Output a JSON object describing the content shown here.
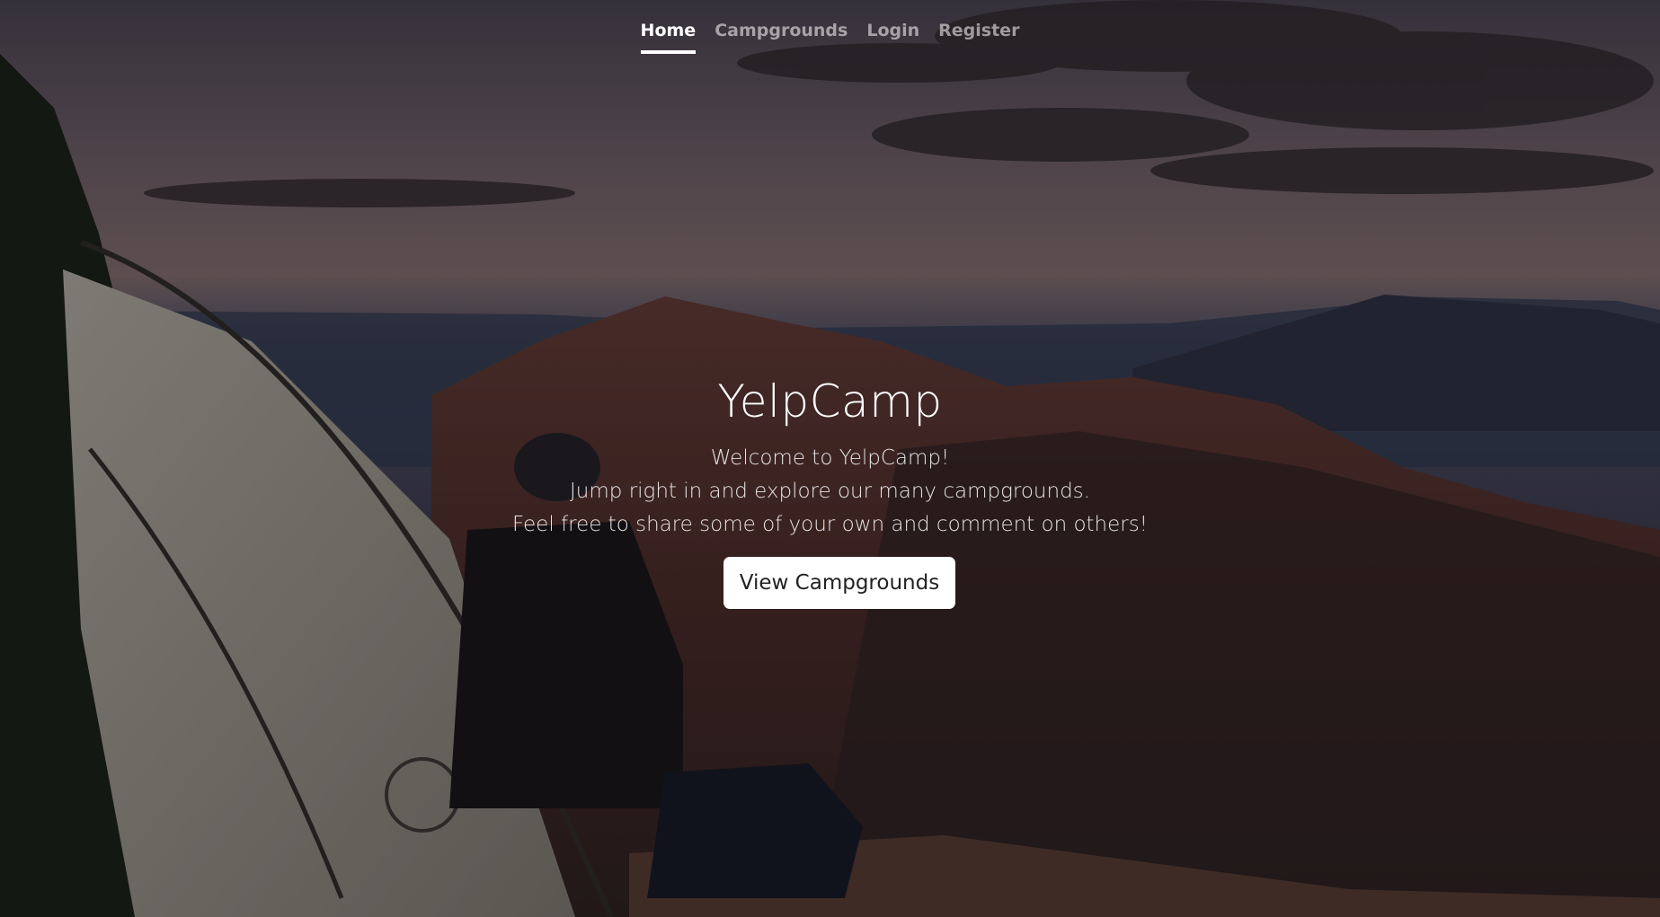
{
  "nav": {
    "items": [
      {
        "label": "Home",
        "active": true
      },
      {
        "label": "Campgrounds",
        "active": false
      },
      {
        "label": "Login",
        "active": false
      },
      {
        "label": "Register",
        "active": false
      }
    ]
  },
  "hero": {
    "title": "YelpCamp",
    "lines": [
      "Welcome to YelpCamp!",
      "Jump right in and explore our many campgrounds.",
      "Feel free to share some of your own and comment on others!"
    ],
    "button_label": "View Campgrounds"
  },
  "colors": {
    "text": "#ffffff",
    "button_bg": "#ffffff",
    "button_text": "#222222"
  }
}
